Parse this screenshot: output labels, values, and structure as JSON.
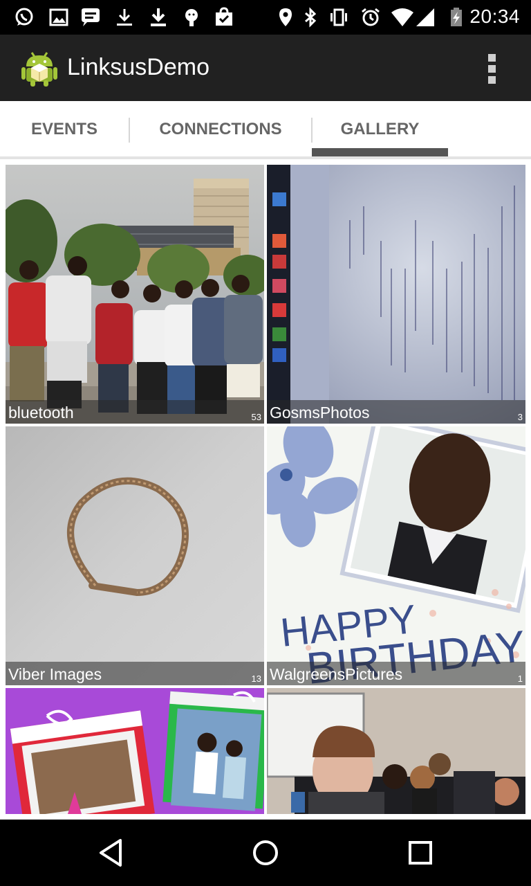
{
  "status_bar": {
    "time": "20:34",
    "left_icons": [
      "whatsapp-icon",
      "image-icon",
      "message-icon",
      "download-icon",
      "download-icon",
      "android-debug-icon",
      "store-icon"
    ],
    "right_icons": [
      "location-icon",
      "bluetooth-icon",
      "vibrate-icon",
      "alarm-icon",
      "wifi-icon",
      "signal-icon",
      "battery-charging-icon"
    ]
  },
  "action_bar": {
    "title": "LinksusDemo",
    "overflow_icon": "overflow-menu-icon"
  },
  "tabs": [
    {
      "label": "EVENTS",
      "selected": false
    },
    {
      "label": "CONNECTIONS",
      "selected": false
    },
    {
      "label": "GALLERY",
      "selected": true
    }
  ],
  "gallery": [
    {
      "name": "bluetooth",
      "count": "53"
    },
    {
      "name": "GosmsPhotos",
      "count": "3"
    },
    {
      "name": "Viber Images",
      "count": "13"
    },
    {
      "name": "WalgreensPictures",
      "count": "1"
    },
    {
      "name": "",
      "count": ""
    },
    {
      "name": "",
      "count": ""
    }
  ],
  "nav_bar": {
    "buttons": [
      "back-icon",
      "home-icon",
      "recents-icon"
    ]
  },
  "colors": {
    "status_bar": "#000000",
    "action_bar": "#212121",
    "tab_text": "#666666",
    "tab_indicator": "#555555",
    "label_overlay": "#282828"
  }
}
